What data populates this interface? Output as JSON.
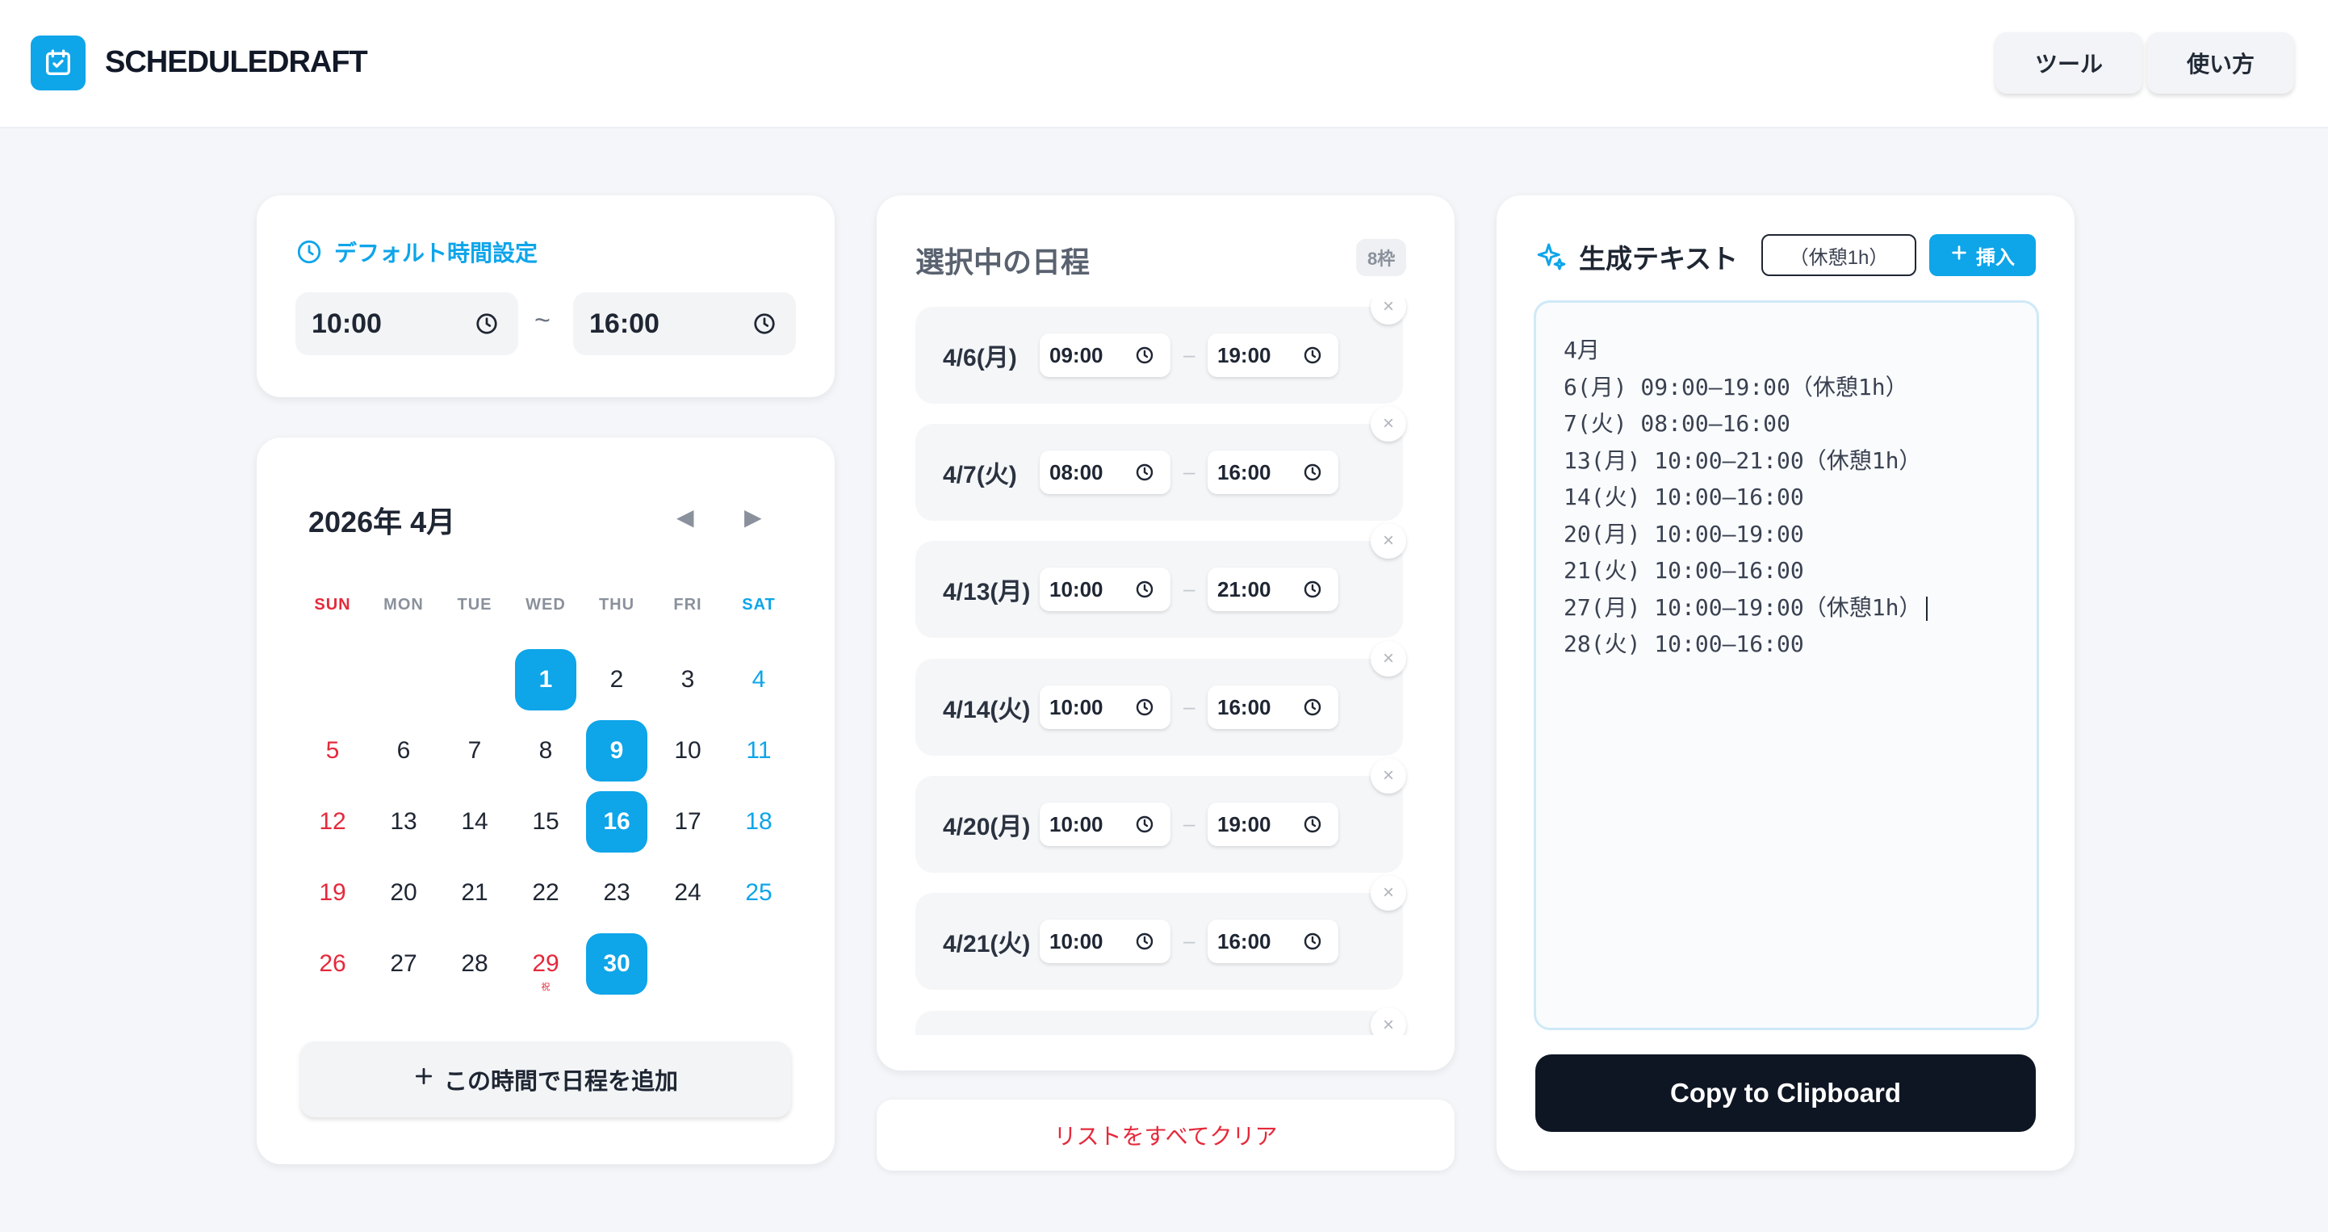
{
  "header": {
    "brand": "SCHEDULEDRAFT",
    "nav": [
      "ツール",
      "使い方"
    ]
  },
  "default_time": {
    "title": "デフォルト時間設定",
    "start": "10:00",
    "separator": "~",
    "end": "16:00"
  },
  "calendar": {
    "month_label": "2026年 4月",
    "prev_glyph": "◀",
    "next_glyph": "▶",
    "weekdays": [
      "SUN",
      "MON",
      "TUE",
      "WED",
      "THU",
      "FRI",
      "SAT"
    ],
    "weeks": [
      [
        null,
        null,
        null,
        {
          "d": "1",
          "sel": true
        },
        {
          "d": "2"
        },
        {
          "d": "3"
        },
        {
          "d": "4"
        }
      ],
      [
        {
          "d": "5"
        },
        {
          "d": "6"
        },
        {
          "d": "7"
        },
        {
          "d": "8"
        },
        {
          "d": "9",
          "sel": true
        },
        {
          "d": "10"
        },
        {
          "d": "11"
        }
      ],
      [
        {
          "d": "12"
        },
        {
          "d": "13"
        },
        {
          "d": "14"
        },
        {
          "d": "15"
        },
        {
          "d": "16",
          "sel": true
        },
        {
          "d": "17"
        },
        {
          "d": "18"
        }
      ],
      [
        {
          "d": "19"
        },
        {
          "d": "20"
        },
        {
          "d": "21"
        },
        {
          "d": "22"
        },
        {
          "d": "23"
        },
        {
          "d": "24"
        },
        {
          "d": "25"
        }
      ],
      [
        {
          "d": "26"
        },
        {
          "d": "27"
        },
        {
          "d": "28"
        },
        {
          "d": "29",
          "holiday": true,
          "sub": "祝"
        },
        {
          "d": "30",
          "sel": true
        },
        null,
        null
      ]
    ],
    "add_button": "この時間で日程を追加"
  },
  "schedule": {
    "title": "選択中の日程",
    "count_badge": "8枠",
    "items": [
      {
        "date": "4/6(月)",
        "start": "09:00",
        "end": "19:00"
      },
      {
        "date": "4/7(火)",
        "start": "08:00",
        "end": "16:00"
      },
      {
        "date": "4/13(月)",
        "start": "10:00",
        "end": "21:00"
      },
      {
        "date": "4/14(火)",
        "start": "10:00",
        "end": "16:00"
      },
      {
        "date": "4/20(月)",
        "start": "10:00",
        "end": "19:00"
      },
      {
        "date": "4/21(火)",
        "start": "10:00",
        "end": "16:00"
      }
    ],
    "dash": "–",
    "remove_glyph": "×",
    "clear_all": "リストをすべてクリア"
  },
  "generated": {
    "title": "生成テキスト",
    "snippet_value": "（休憩1h）",
    "insert_button": "挿入",
    "lines": [
      "4月",
      "6(月) 09:00–19:00（休憩1h）",
      "7(火) 08:00–16:00",
      "13(月) 10:00–21:00（休憩1h）",
      "14(火) 10:00–16:00",
      "20(月) 10:00–19:00",
      "21(火) 10:00–16:00",
      "27(月) 10:00–19:00（休憩1h）",
      "28(火) 10:00–16:00"
    ],
    "copy_button": "Copy to Clipboard"
  },
  "colors": {
    "accent": "#0ea5e9",
    "sunday": "#e5293b",
    "dark": "#0f1623"
  }
}
